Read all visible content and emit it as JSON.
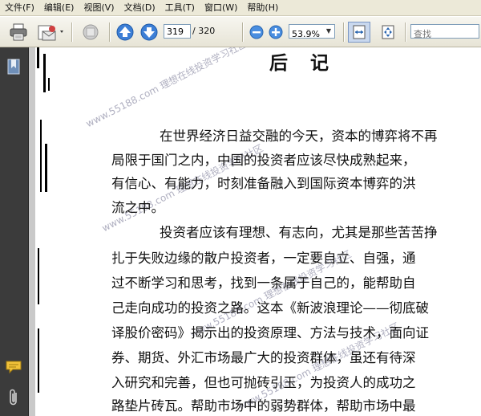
{
  "menu": [
    "文件(F)",
    "编辑(E)",
    "视图(V)",
    "文档(D)",
    "工具(T)",
    "窗口(W)",
    "帮助(H)"
  ],
  "toolbar": {
    "page_current": "319",
    "page_total": "/ 320",
    "zoom": "53.9%",
    "search_placeholder": "查找"
  },
  "document": {
    "heading": "后 记",
    "lines": [
      "在世界经济日益交融的今天，资本的博弈将不再",
      "局限于国门之内，中国的投资者应该尽快成熟起来，",
      "有信心、有能力，时刻准备融入到国际资本博弈的洪",
      "流之中。",
      "投资者应该有理想、有志向，尤其是那些苦苦挣",
      "扎于失败边缘的散户投资者，一定要自立、自强，通",
      "过不断学习和思考，找到一条属于自己的，能帮助自",
      "己走向成功的投资之路。这本《新波浪理论——彻底破",
      "译股价密码》揭示出的投资原理、方法与技术，面向证",
      "券、期货、外汇市场最广大的投资群体，虽还有待深",
      "入研究和完善，但也可抛砖引玉，为投资人的成功之",
      "路垫片砖瓦。帮助市场中的弱势群体，帮助市场中最"
    ],
    "watermarks": [
      "www.55188.com 理想在线投资学习社区",
      "www.55188.com 理想在线投资学习社区",
      "www.55188.com 理想在线投资学习社区",
      "www.55188.com 理想在线投资学习社区"
    ]
  }
}
